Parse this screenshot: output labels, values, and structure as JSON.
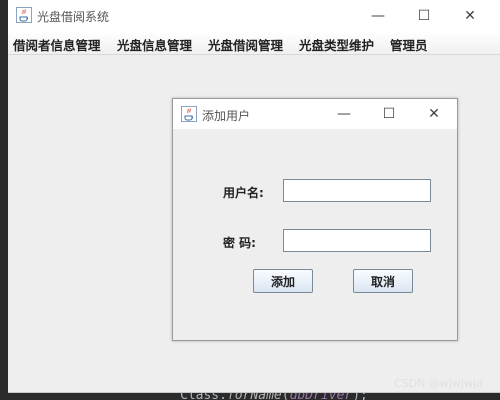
{
  "main_window": {
    "title": "光盘借阅系统",
    "icon": "java-icon",
    "controls": {
      "minimize": "—",
      "maximize": "☐",
      "close": "✕"
    }
  },
  "menubar": {
    "items": [
      {
        "label": "借阅者信息管理"
      },
      {
        "label": "光盘信息管理"
      },
      {
        "label": "光盘借阅管理"
      },
      {
        "label": "光盘类型维护"
      },
      {
        "label": "管理员"
      }
    ]
  },
  "dialog": {
    "title": "添加用户",
    "icon": "java-icon",
    "controls": {
      "minimize": "—",
      "maximize": "☐",
      "close": "✕"
    },
    "form": {
      "username_label": "用户名:",
      "username_value": "",
      "password_label": "密 码:",
      "password_value": ""
    },
    "buttons": {
      "add": "添加",
      "cancel": "取消"
    }
  },
  "background": {
    "code_prefix": "Class.",
    "code_method": "forName",
    "code_open": "(",
    "code_param": "dbDriver",
    "code_close": ");",
    "watermark": "CSDN @wjwjwjd"
  },
  "colors": {
    "titlebar": "#ffffff",
    "window_bg": "#eeeeee",
    "button_gradient_top": "#f8fbff",
    "button_gradient_bottom": "#dbe6f2",
    "editor_bg": "#2b2b2b"
  }
}
